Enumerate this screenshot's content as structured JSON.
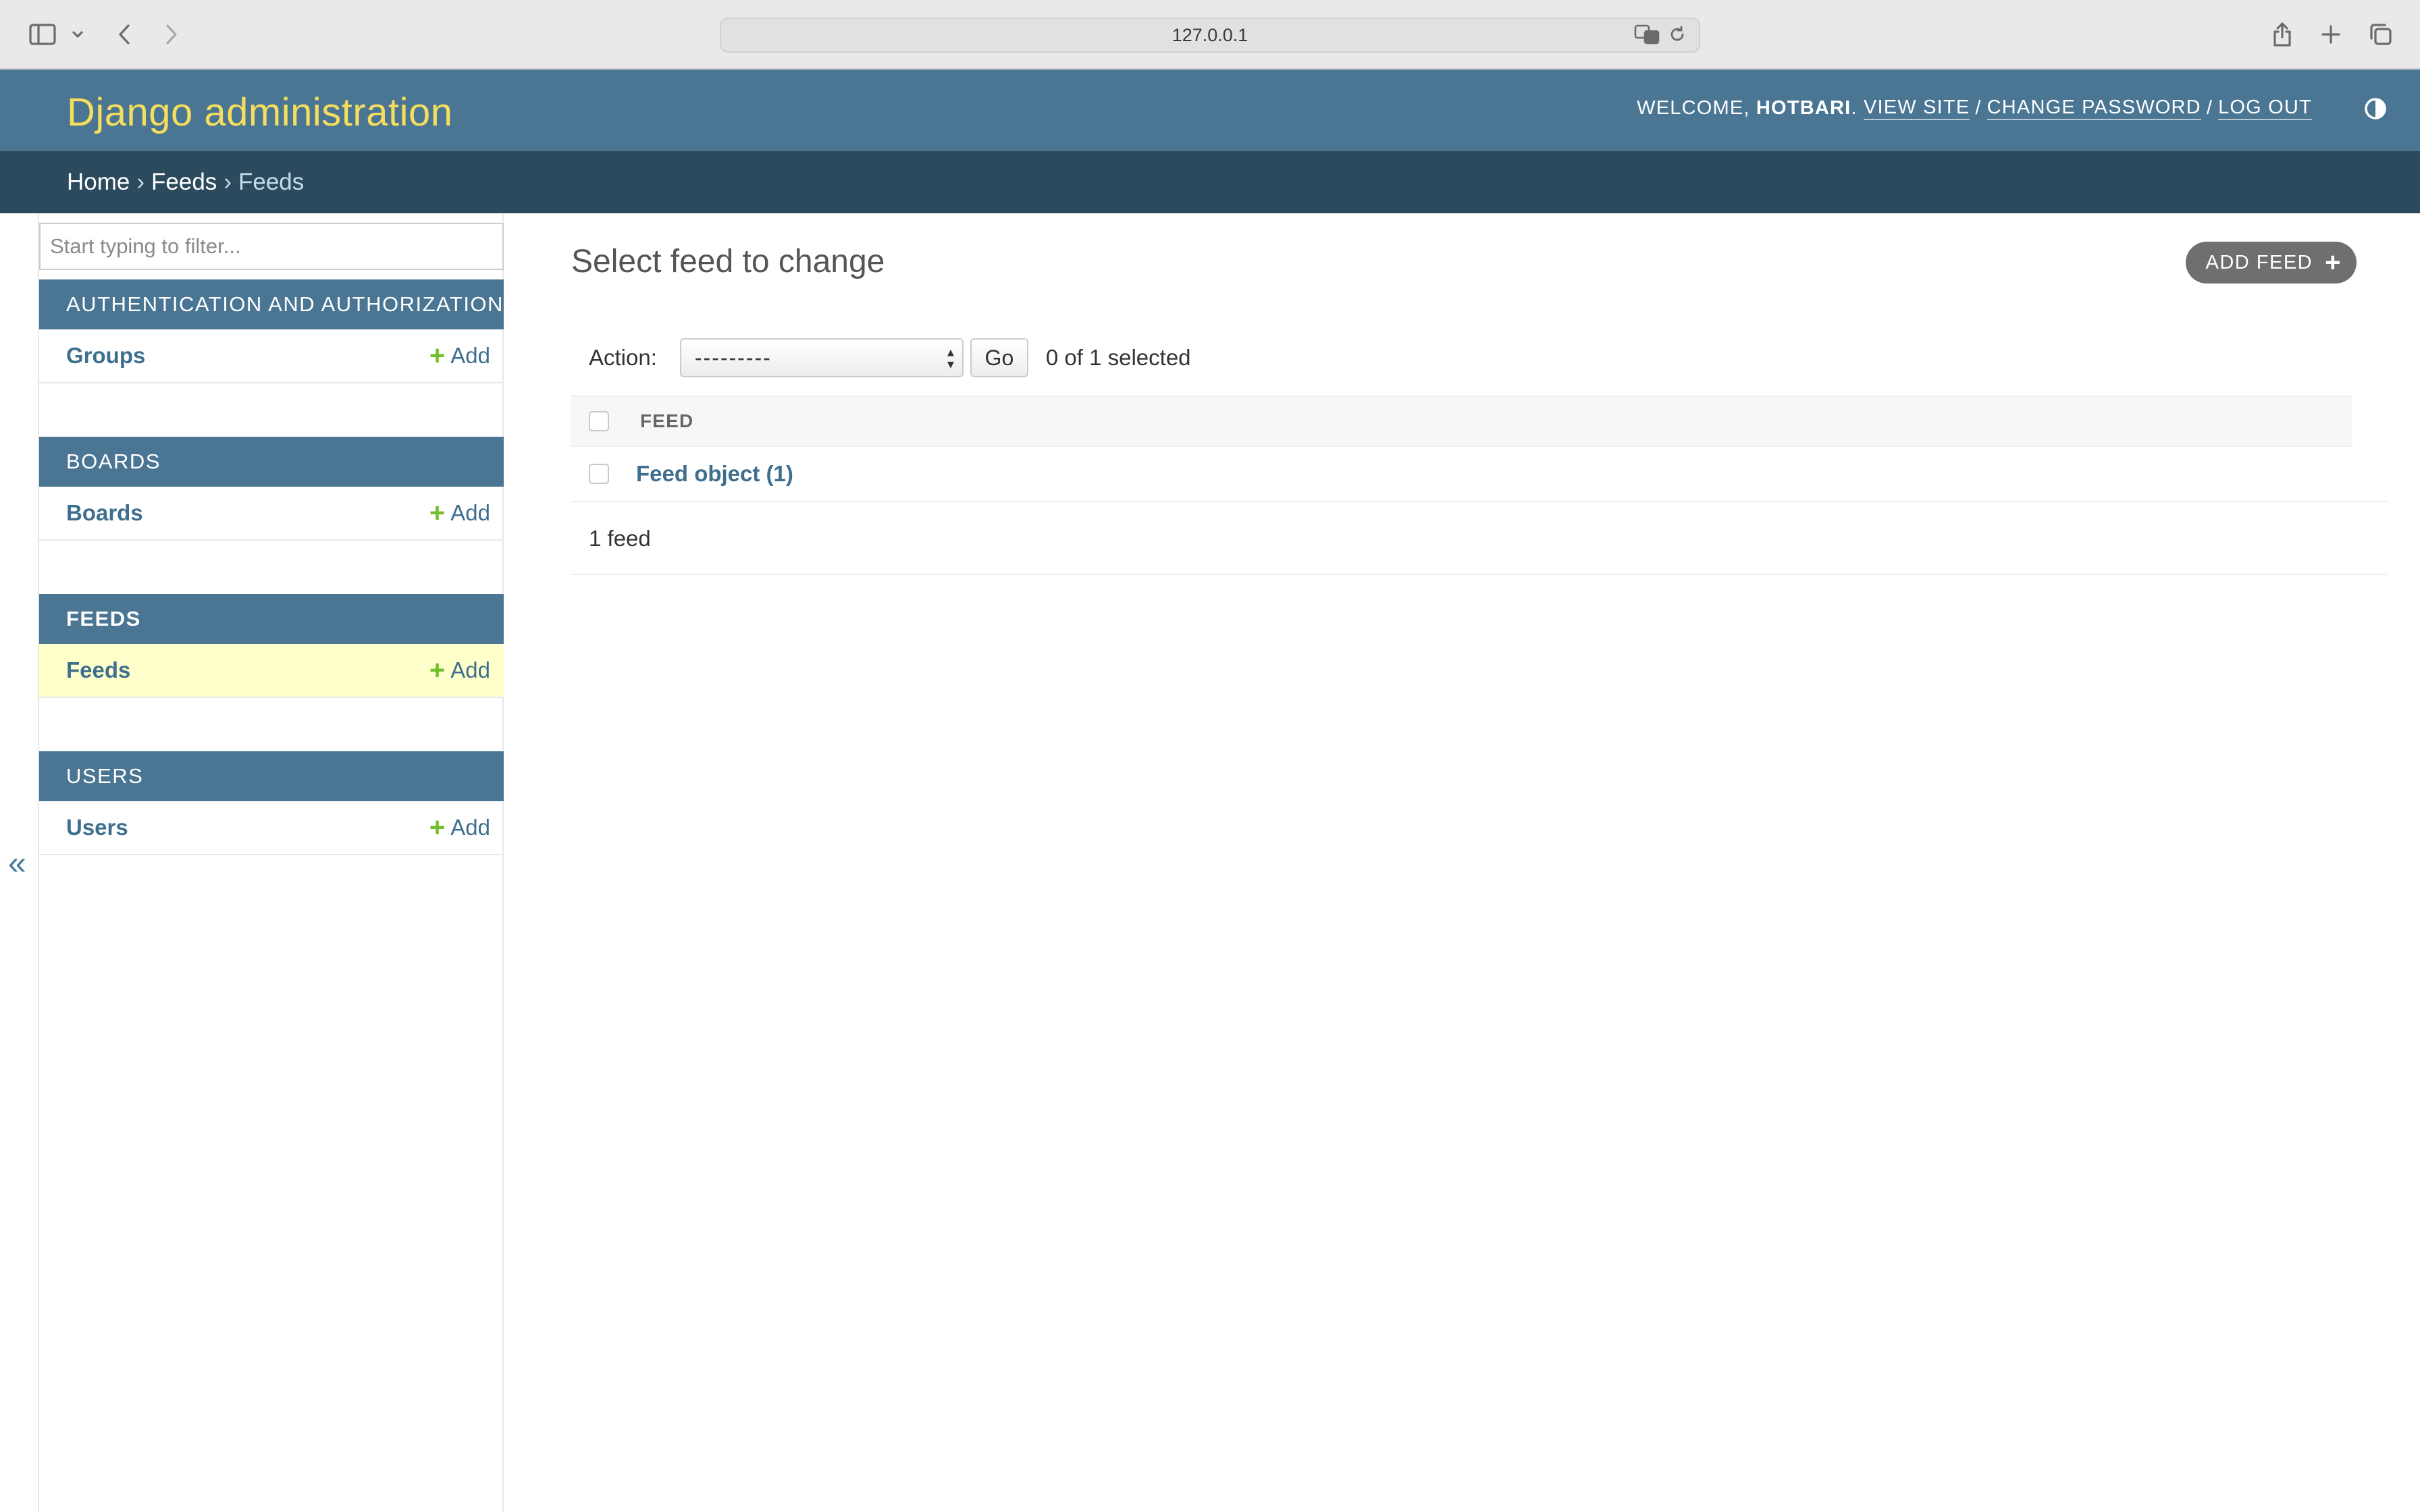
{
  "browser": {
    "url": "127.0.0.1"
  },
  "header": {
    "branding": "Django administration",
    "welcome": "Welcome,",
    "username": "hotbari",
    "view_site": "View site",
    "change_password": "Change password",
    "log_out": "Log out",
    "separator": "/"
  },
  "breadcrumbs": {
    "home": "Home",
    "app": "Feeds",
    "current": "Feeds",
    "separator": "›"
  },
  "sidebar": {
    "filter_placeholder": "Start typing to filter...",
    "add_label": "Add",
    "modules": [
      {
        "caption": "Authentication and Authorization",
        "model": "Groups"
      },
      {
        "caption": "Boards",
        "model": "Boards"
      },
      {
        "caption": "Feeds",
        "model": "Feeds"
      },
      {
        "caption": "Users",
        "model": "Users"
      }
    ],
    "collapse_glyph": "«"
  },
  "content": {
    "title": "Select feed to change",
    "add_button": "Add feed",
    "action_label": "Action:",
    "action_selected": "---------",
    "go_label": "Go",
    "selected_count": "0 of 1 selected",
    "column_header": "Feed",
    "rows": [
      {
        "label": "Feed object (1)"
      }
    ],
    "paginator": "1 feed"
  },
  "colors": {
    "header_bg": "#4a7694",
    "breadcrumb_bg": "#2c4a5d",
    "branding": "#f5dd5d",
    "link": "#3f6f8e",
    "add_plus": "#70bf2b",
    "selected_row": "#ffffcc"
  }
}
